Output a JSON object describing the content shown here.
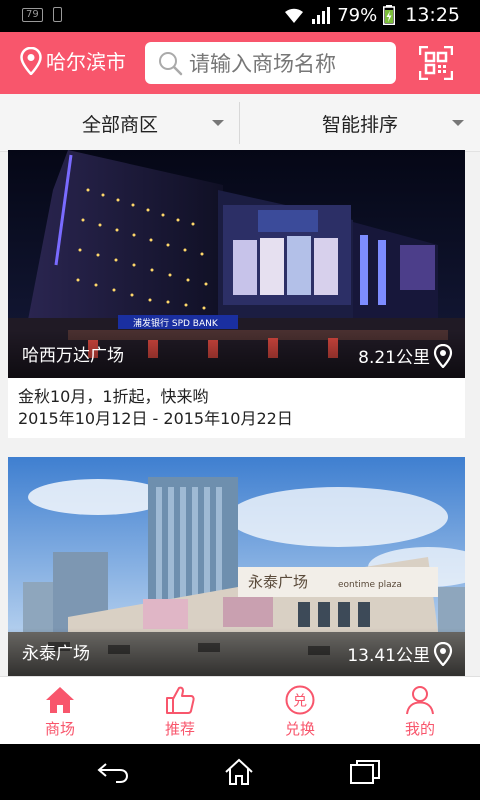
{
  "status_bar": {
    "badge": "79",
    "battery": "79%",
    "time": "13:25"
  },
  "header": {
    "city": "哈尔滨市",
    "search_placeholder": "请输入商场名称"
  },
  "filters": {
    "district": "全部商区",
    "sort": "智能排序"
  },
  "malls": [
    {
      "name": "哈西万达广场",
      "distance": "8.21公里",
      "promo_title": "金秋10月，1折起，快来哟",
      "promo_dates": "2015年10月12日 - 2015年10月22日"
    },
    {
      "name": "永泰广场",
      "distance": "13.41公里"
    }
  ],
  "image_signs": {
    "bank_sign": "浦发银行 SPD BANK",
    "plaza_sign_cn": "永泰广场",
    "plaza_sign_en": "eontime plaza"
  },
  "tabs": [
    {
      "label": "商场",
      "icon": "home-icon"
    },
    {
      "label": "推荐",
      "icon": "thumbs-up-icon"
    },
    {
      "label": "兑换",
      "icon": "exchange-icon"
    },
    {
      "label": "我的",
      "icon": "user-icon"
    }
  ],
  "colors": {
    "accent": "#f8566c",
    "background": "#f2f2f2"
  }
}
